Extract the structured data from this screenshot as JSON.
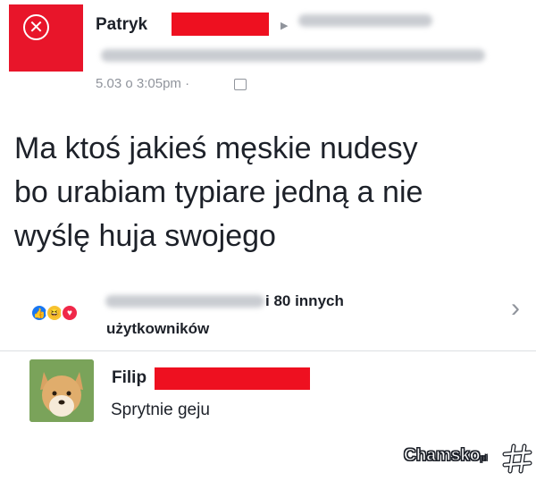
{
  "post": {
    "author": "Patryk",
    "timestamp": "5.03 o 3:05pm",
    "separator": "·",
    "body_lines": [
      "Ma ktoś jakieś męskie nudesy",
      "bo urabiam typiare jedną a nie",
      "wyślę huja swojego"
    ]
  },
  "reactions": {
    "count_line1": "i 80 innych",
    "count_line2": "użytkowników",
    "chevron": "›"
  },
  "comment": {
    "author": "Filip",
    "text": "Sprytnie geju"
  },
  "watermark": {
    "brand": "Chamsko",
    "suffix": "pl"
  },
  "colors": {
    "accent": "#e8152a",
    "text": "#1d2129",
    "meta": "#90949c"
  }
}
